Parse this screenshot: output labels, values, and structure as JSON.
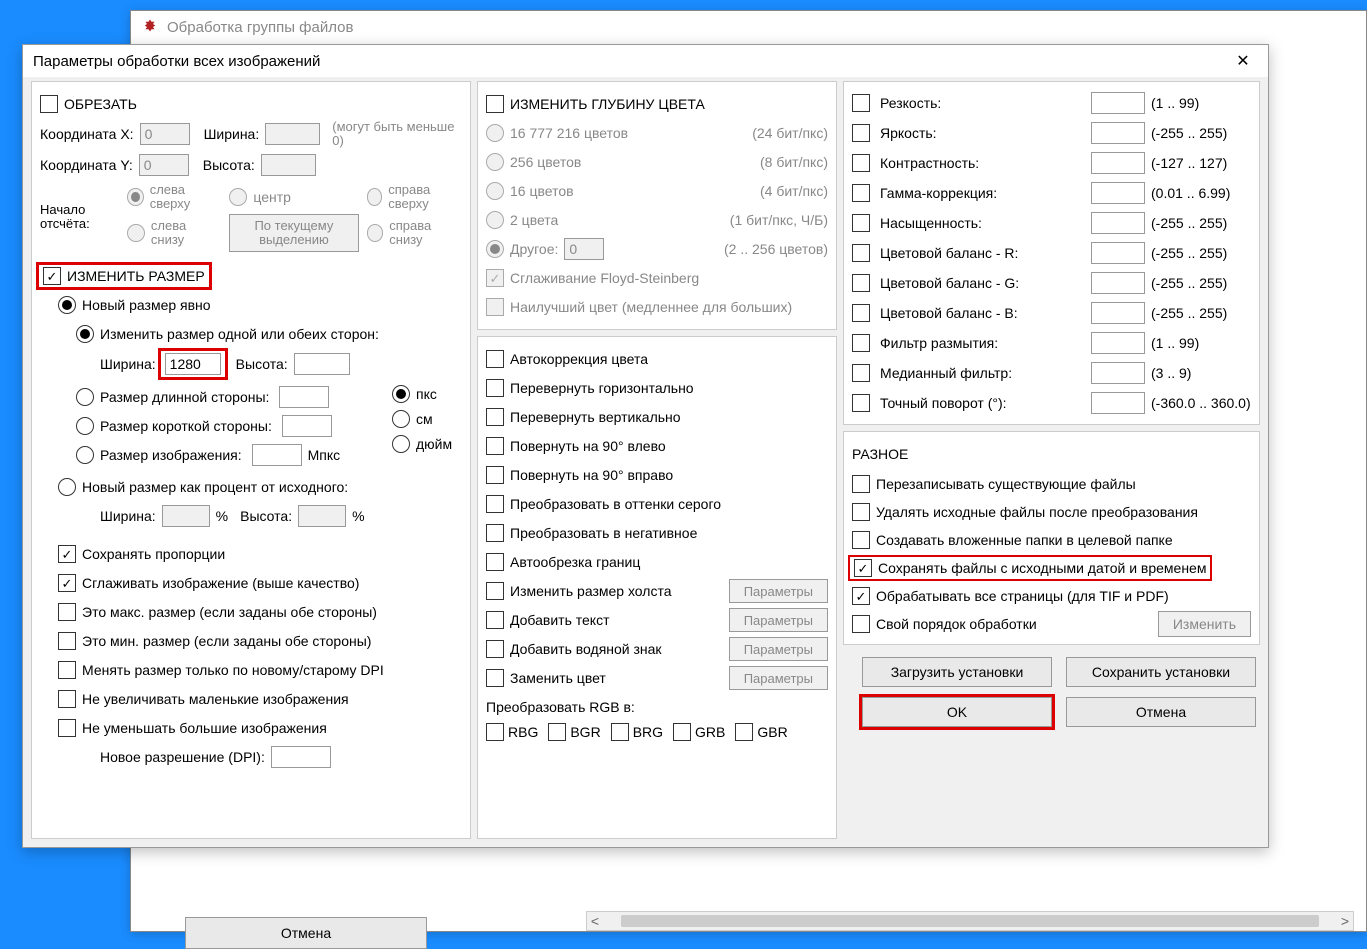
{
  "parent_window_title": "Обработка группы файлов",
  "dialog_title": "Параметры обработки всех изображений",
  "crop": {
    "heading": "ОБРЕЗАТЬ",
    "coord_x_label": "Координата X:",
    "coord_x_value": "0",
    "width_label": "Ширина:",
    "coord_y_label": "Координата Y:",
    "coord_y_value": "0",
    "height_label": "Высота:",
    "hint": "(могут быть меньше 0)",
    "origin_label": "Начало отсчёта:",
    "origin_tl": "слева сверху",
    "origin_center": "центр",
    "origin_tr": "справа сверху",
    "origin_bl": "слева снизу",
    "origin_cursel": "По текущему выделению",
    "origin_br": "справа снизу"
  },
  "resize": {
    "heading": "ИЗМЕНИТЬ РАЗМЕР",
    "explicit": "Новый размер явно",
    "one_or_both": "Изменить размер одной или обеих сторон:",
    "width_label": "Ширина:",
    "width_value": "1280",
    "height_label": "Высота:",
    "long_side": "Размер длинной стороны:",
    "short_side": "Размер короткой стороны:",
    "image_size": "Размер изображения:",
    "unit_px": "пкс",
    "unit_cm": "см",
    "unit_inch": "дюйм",
    "unit_mpx": "Мпкс",
    "percent_new": "Новый размер как процент от исходного:",
    "pct_width": "Ширина:",
    "pct_height": "Высота:",
    "keep_ratio": "Сохранять пропорции",
    "resample": "Сглаживать изображение (выше качество)",
    "is_max": "Это макс. размер (если заданы обе стороны)",
    "is_min": "Это мин. размер (если заданы обе стороны)",
    "dpi_only": "Менять размер только по новому/старому DPI",
    "no_enlarge": "Не увеличивать маленькие изображения",
    "no_shrink": "Не уменьшать большие изображения",
    "new_dpi": "Новое разрешение (DPI):"
  },
  "depth": {
    "heading": "ИЗМЕНИТЬ ГЛУБИНУ ЦВЕТА",
    "c16m": "16 777 216 цветов",
    "c16m_hint": "(24 бит/пкс)",
    "c256": "256 цветов",
    "c256_hint": "(8 бит/пкс)",
    "c16": "16 цветов",
    "c16_hint": "(4 бит/пкс)",
    "c2": "2 цвета",
    "c2_hint": "(1 бит/пкс, Ч/Б)",
    "other": "Другое:",
    "other_value": "0",
    "other_hint": "(2 .. 256 цветов)",
    "fs": "Сглаживание Floyd-Steinberg",
    "bestcolor": "Наилучший цвет (медленнее для больших)"
  },
  "ops": {
    "auto_color": "Автокоррекция цвета",
    "flip_h": "Перевернуть горизонтально",
    "flip_v": "Перевернуть вертикально",
    "rot_l": "Повернуть на 90° влево",
    "rot_r": "Повернуть на 90° вправо",
    "gray": "Преобразовать в оттенки серого",
    "neg": "Преобразовать в негативное",
    "autocrop": "Автообрезка границ",
    "canvas": "Изменить размер холста",
    "text": "Добавить текст",
    "wm": "Добавить водяной знак",
    "replace_color": "Заменить цвет",
    "params": "Параметры",
    "rgb_to": "Преобразовать RGB в:",
    "rbg": "RBG",
    "bgr": "BGR",
    "brg": "BRG",
    "grb": "GRB",
    "gbr": "GBR"
  },
  "adjust": {
    "sharpen": "Резкость:",
    "sharpen_hint": "(1 .. 99)",
    "bright": "Яркость:",
    "bright_hint": "(-255 .. 255)",
    "contrast": "Контрастность:",
    "contrast_hint": "(-127 .. 127)",
    "gamma": "Гамма-коррекция:",
    "gamma_hint": "(0.01 .. 6.99)",
    "sat": "Насыщенность:",
    "sat_hint": "(-255 .. 255)",
    "cbr": "Цветовой баланс - R:",
    "cbr_hint": "(-255 .. 255)",
    "cbg": "Цветовой баланс - G:",
    "cbg_hint": "(-255 .. 255)",
    "cbb": "Цветовой баланс - B:",
    "cbb_hint": "(-255 .. 255)",
    "blur": "Фильтр размытия:",
    "blur_hint": "(1 .. 99)",
    "median": "Медианный фильтр:",
    "median_hint": "(3 .. 9)",
    "finerot": "Точный поворот (°):",
    "finerot_hint": "(-360.0 .. 360.0)"
  },
  "misc": {
    "heading": "РАЗНОЕ",
    "overwrite": "Перезаписывать существующие файлы",
    "delete_src": "Удалять исходные файлы после преобразования",
    "subfolders": "Создавать вложенные папки в целевой папке",
    "keep_date": "Сохранять файлы с исходными датой и временем",
    "all_pages": "Обрабатывать все страницы (для TIF и PDF)",
    "own_order": "Свой порядок обработки",
    "change": "Изменить"
  },
  "buttons": {
    "load": "Загрузить установки",
    "save": "Сохранить установки",
    "ok": "OK",
    "cancel": "Отмена"
  },
  "footer_cancel": "Отмена"
}
